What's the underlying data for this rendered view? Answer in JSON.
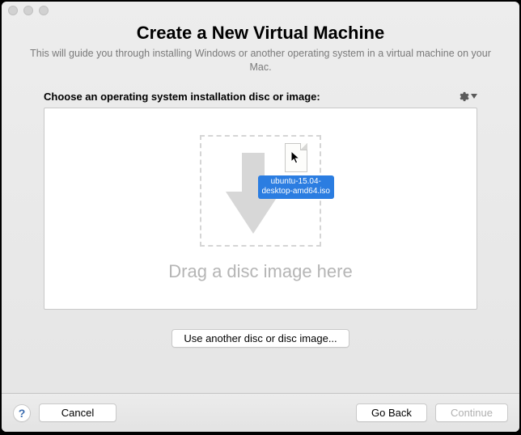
{
  "header": {
    "title": "Create a New Virtual Machine",
    "subtitle": "This will guide you through installing Windows or another operating system in a virtual machine on your Mac."
  },
  "section": {
    "label": "Choose an operating system installation disc or image:"
  },
  "dropzone": {
    "file_label": "ubuntu-15.04-\ndesktop-amd64.iso",
    "placeholder": "Drag a disc image here"
  },
  "buttons": {
    "use_another": "Use another disc or disc image...",
    "cancel": "Cancel",
    "go_back": "Go Back",
    "continue": "Continue",
    "help": "?"
  },
  "colors": {
    "selection": "#2b7de1"
  }
}
